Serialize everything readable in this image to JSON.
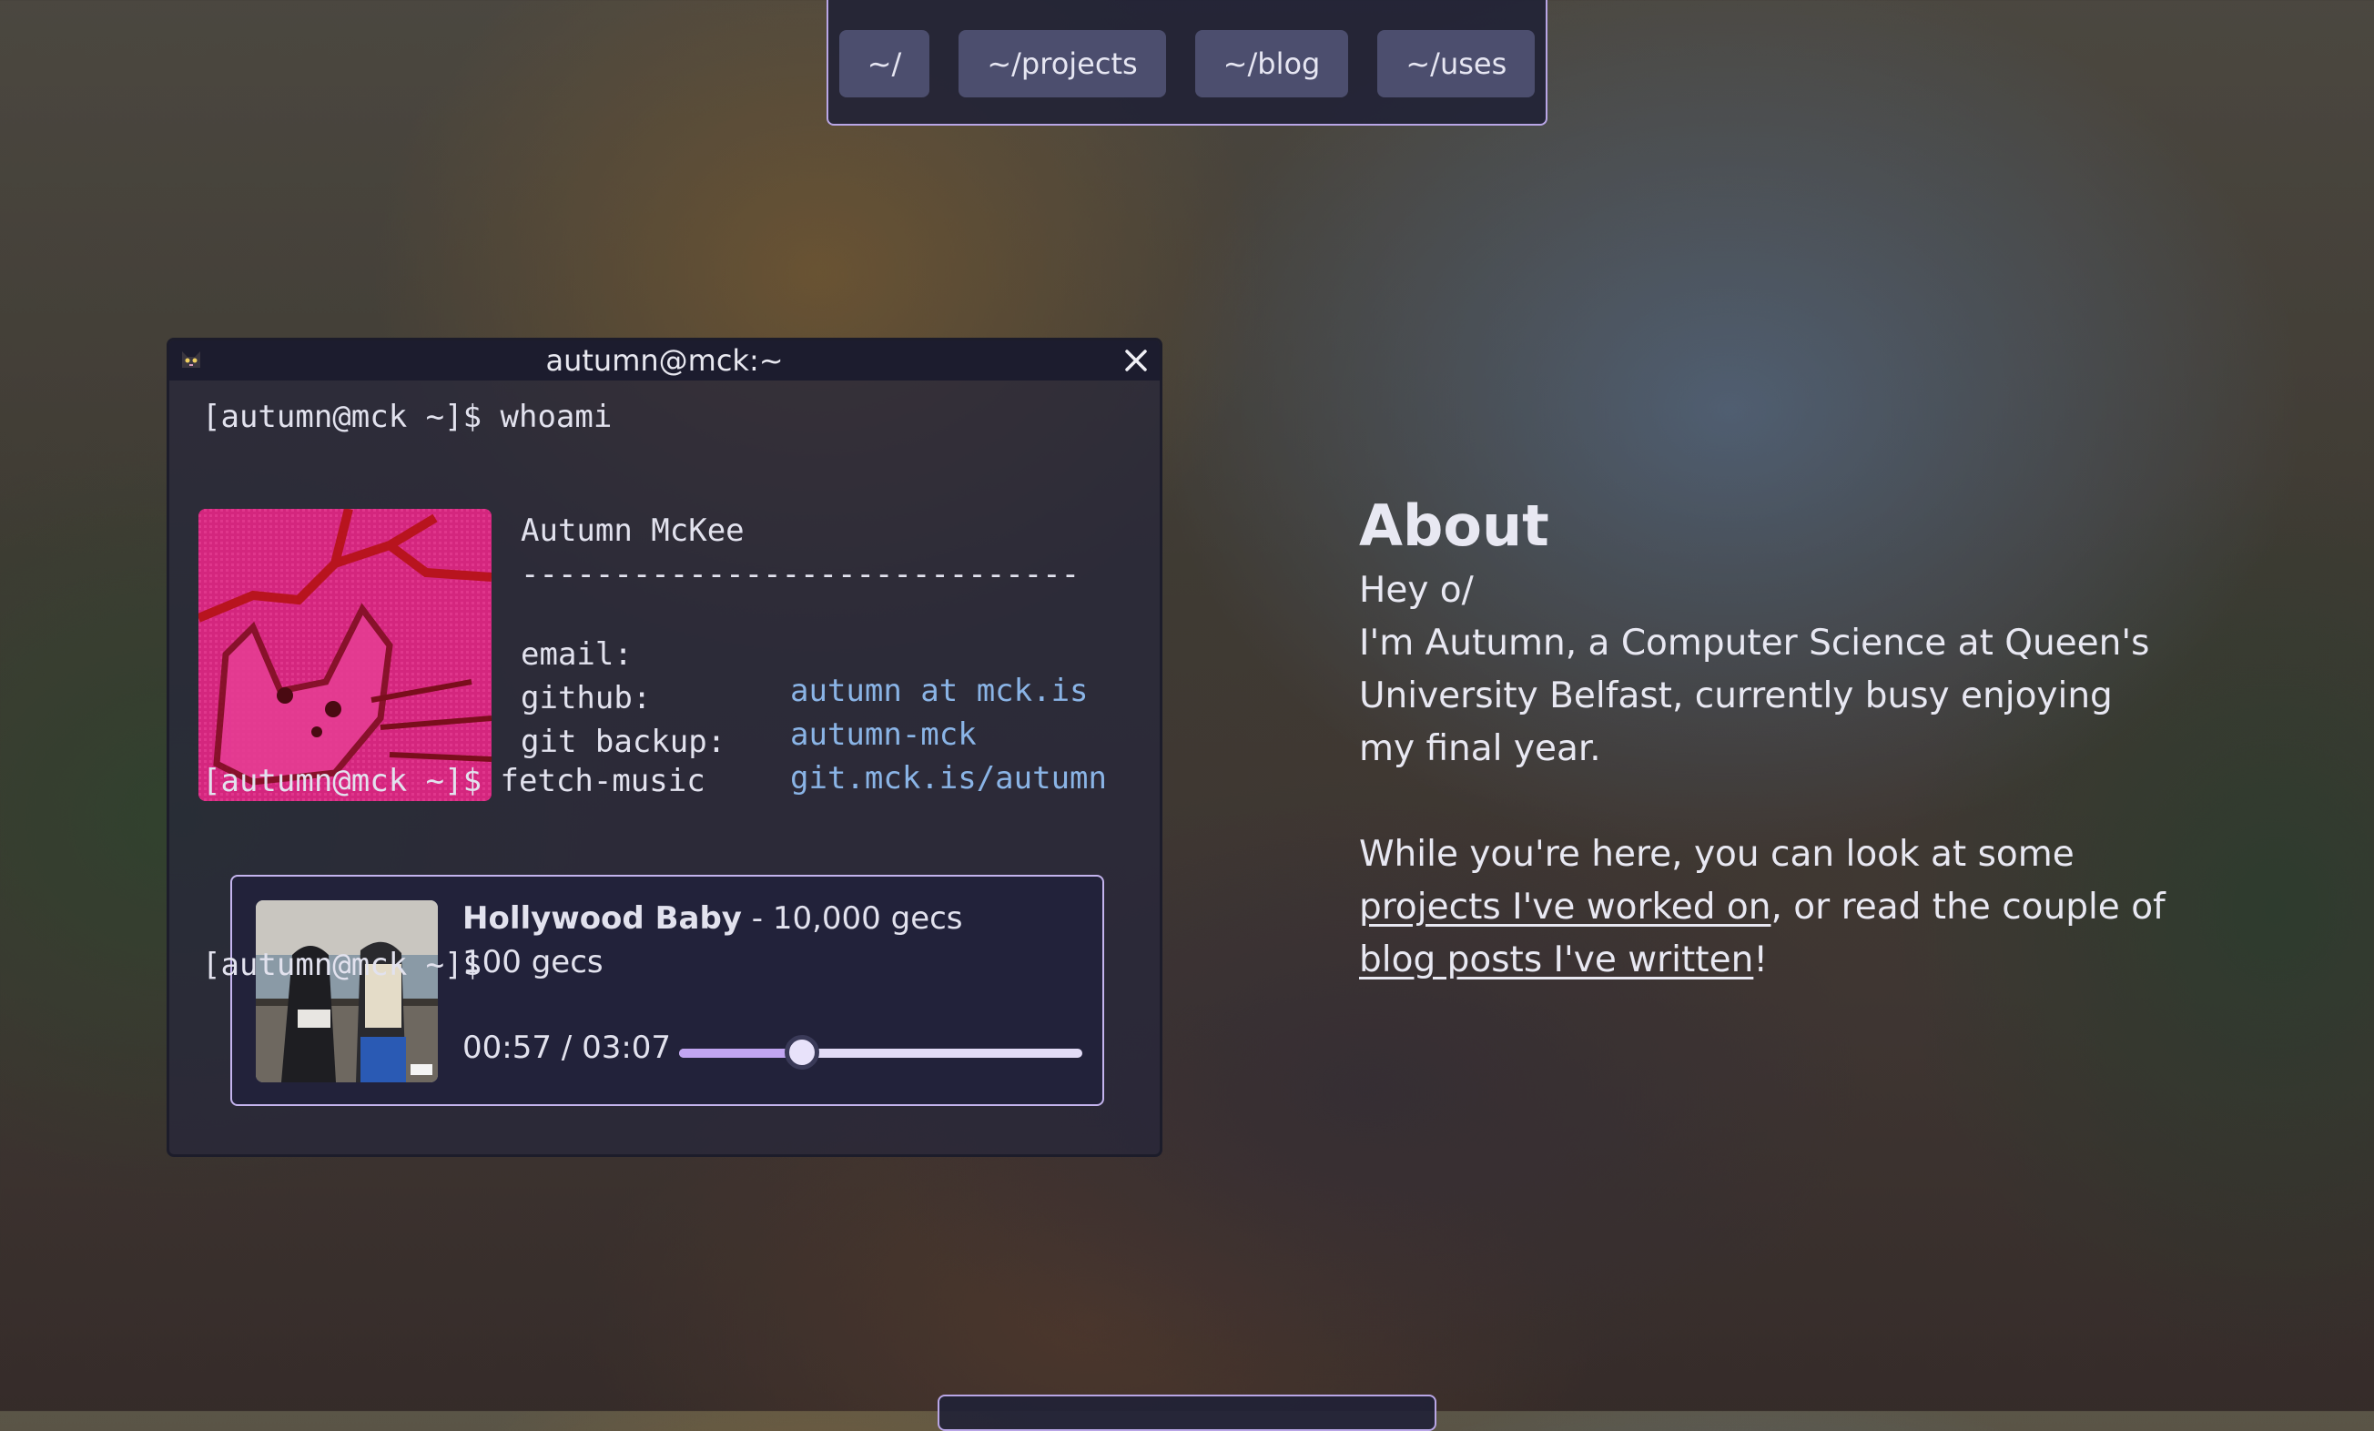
{
  "nav": {
    "items": [
      "~/",
      "~/projects",
      "~/blog",
      "~/uses"
    ]
  },
  "terminal": {
    "title": "autumn@mck:~",
    "prompt1": "[autumn@mck ~]$ whoami",
    "name": "Autumn McKee",
    "separator": "------------------------------",
    "rows": [
      {
        "key": "email:",
        "value": "autumn at mck.is"
      },
      {
        "key": "github:",
        "value": "autumn-mck"
      },
      {
        "key": "git backup:",
        "value": "git.mck.is/autumn"
      }
    ],
    "prompt2": "[autumn@mck ~]$ fetch-music",
    "prompt3": "[autumn@mck ~]$"
  },
  "music": {
    "title": "Hollywood Baby",
    "subtitle": "- 10,000 gecs",
    "artist": "100 gecs",
    "elapsed": "00:57",
    "divider": "/",
    "duration": "03:07",
    "progress": 0.3048
  },
  "about": {
    "heading": "About",
    "line1": "Hey o/",
    "line2": "I'm Autumn, a Computer Science at Queen's University Belfast, currently busy enjoying my final year.",
    "p2_before": "While you're here, you can look at some ",
    "link_projects": "projects I've worked on",
    "p2_middle": ", or read the couple of ",
    "link_blog": "blog posts I've written",
    "p2_after": "!"
  },
  "colors": {
    "accent": "#b9a6e6",
    "link": "#8ab4e6",
    "slider_fill": "#c2a6f2"
  },
  "icons": {
    "window_icon": "cat-face-icon",
    "close": "close-icon"
  }
}
